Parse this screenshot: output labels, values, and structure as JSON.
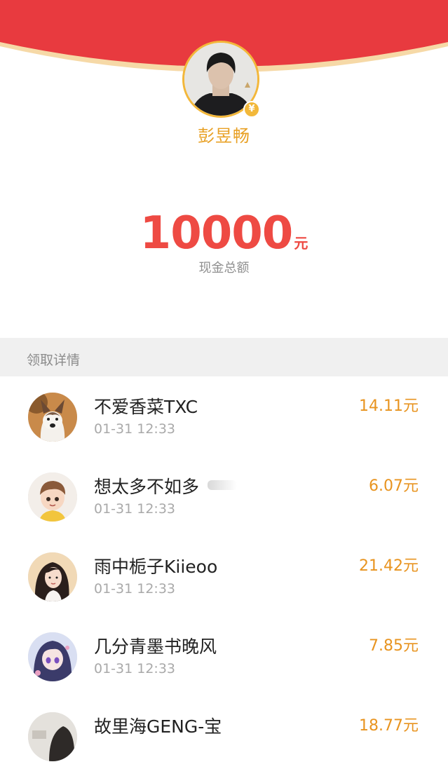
{
  "header": {
    "primary_color": "#e83a3f",
    "accent_color": "#f6d9a7"
  },
  "sender": {
    "name": "彭昱畅",
    "avatar_icon": "user-photo-icon",
    "badge_icon": "vip-coin-icon",
    "badge_text": "¥"
  },
  "summary": {
    "amount": "10000",
    "unit": "元",
    "label": "现金总额"
  },
  "list": {
    "header": "领取详情",
    "items": [
      {
        "name": "不爱香菜TXC",
        "time": "01-31 12:33",
        "amount": "14.11元",
        "avatar_icon": "dog-avatar-icon"
      },
      {
        "name": "想太多不如多",
        "time": "01-31 12:33",
        "amount": "6.07元",
        "avatar_icon": "cartoon-boy-avatar-icon"
      },
      {
        "name": "雨中栀子Kiieoo",
        "time": "01-31 12:33",
        "amount": "21.42元",
        "avatar_icon": "girl-avatar-icon"
      },
      {
        "name": "几分青墨书晚风",
        "time": "01-31 12:33",
        "amount": "7.85元",
        "avatar_icon": "anime-girl-avatar-icon"
      },
      {
        "name": "故里海GENG-宝",
        "time": "",
        "amount": "18.77元",
        "avatar_icon": "user-avatar-icon"
      }
    ]
  }
}
